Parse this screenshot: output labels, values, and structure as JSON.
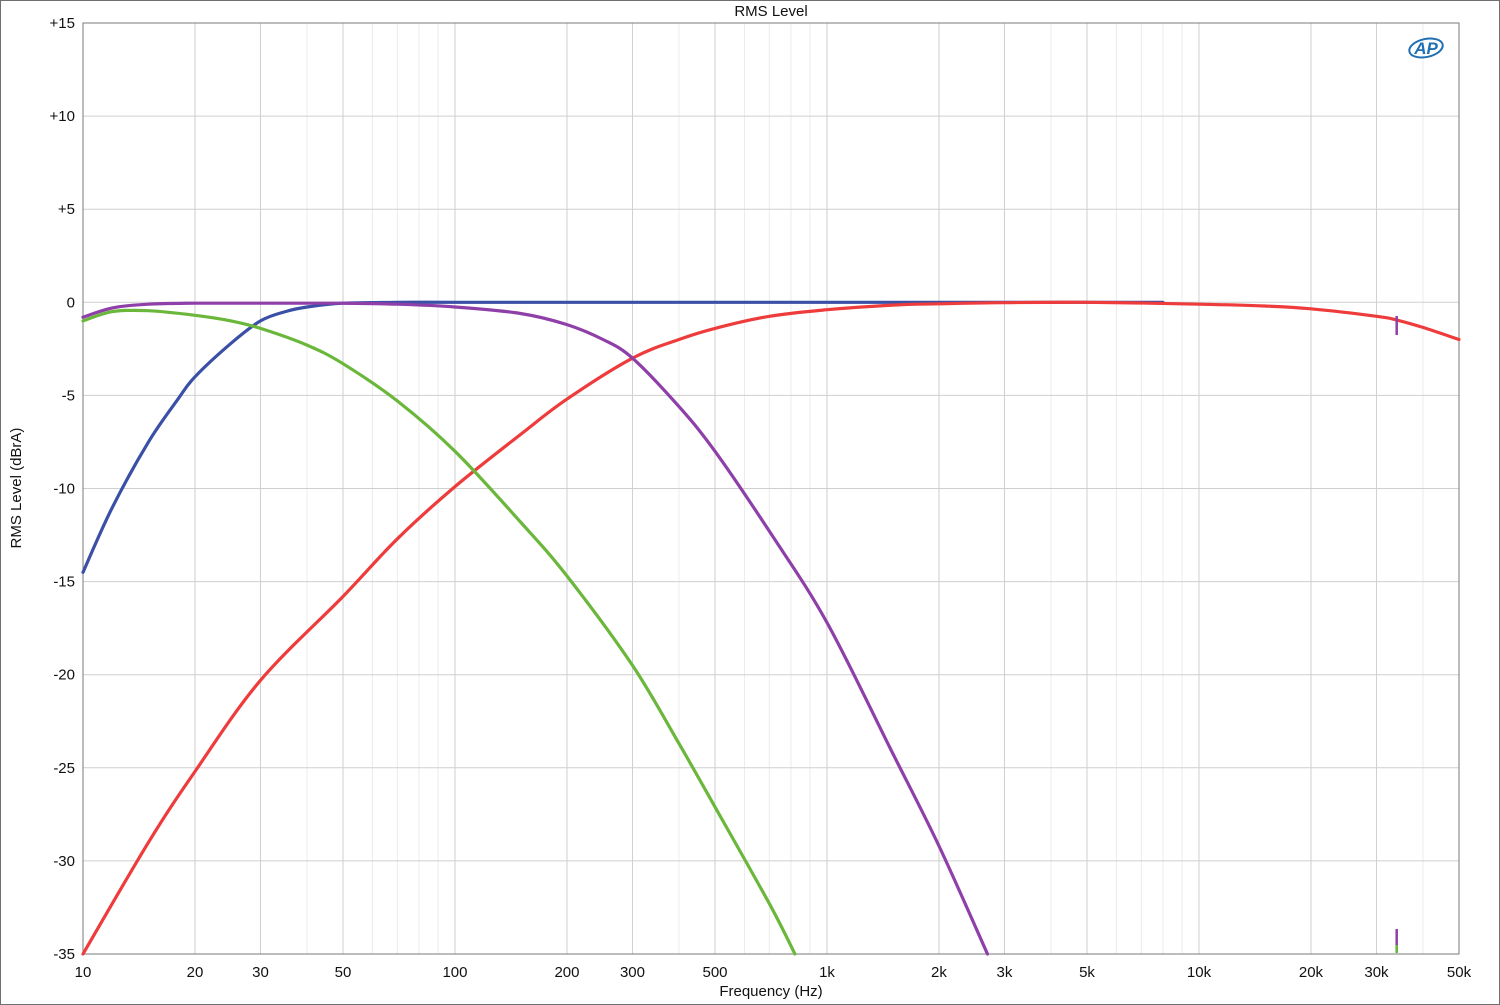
{
  "chart_data": {
    "type": "line",
    "title": "RMS Level",
    "xlabel": "Frequency (Hz)",
    "ylabel": "RMS Level (dBrA)",
    "x_scale": "log",
    "xlim": [
      10,
      50000
    ],
    "ylim": [
      -35,
      15
    ],
    "grid": true,
    "x_ticks": [
      {
        "value": 10,
        "label": "10"
      },
      {
        "value": 20,
        "label": "20"
      },
      {
        "value": 30,
        "label": "30"
      },
      {
        "value": 50,
        "label": "50"
      },
      {
        "value": 100,
        "label": "100"
      },
      {
        "value": 200,
        "label": "200"
      },
      {
        "value": 300,
        "label": "300"
      },
      {
        "value": 500,
        "label": "500"
      },
      {
        "value": 1000,
        "label": "1k"
      },
      {
        "value": 2000,
        "label": "2k"
      },
      {
        "value": 3000,
        "label": "3k"
      },
      {
        "value": 5000,
        "label": "5k"
      },
      {
        "value": 10000,
        "label": "10k"
      },
      {
        "value": 20000,
        "label": "20k"
      },
      {
        "value": 30000,
        "label": "30k"
      },
      {
        "value": 50000,
        "label": "50k"
      }
    ],
    "y_ticks": [
      {
        "value": 15,
        "label": "+15"
      },
      {
        "value": 10,
        "label": "+10"
      },
      {
        "value": 5,
        "label": "+5"
      },
      {
        "value": 0,
        "label": "0"
      },
      {
        "value": -5,
        "label": "-5"
      },
      {
        "value": -10,
        "label": "-10"
      },
      {
        "value": -15,
        "label": "-15"
      },
      {
        "value": -20,
        "label": "-20"
      },
      {
        "value": -25,
        "label": "-25"
      },
      {
        "value": -30,
        "label": "-30"
      },
      {
        "value": -35,
        "label": "-35"
      }
    ],
    "series": [
      {
        "color": "#3a4fa6",
        "x": [
          10,
          12,
          15,
          18,
          20,
          25,
          30,
          35,
          40,
          50,
          70,
          100,
          200,
          500,
          1000,
          2000,
          5000,
          8000
        ],
        "y": [
          -14.5,
          -11.0,
          -7.5,
          -5.2,
          -4.0,
          -2.2,
          -1.0,
          -0.5,
          -0.25,
          -0.05,
          0,
          0,
          0,
          0,
          0,
          0,
          0,
          0
        ]
      },
      {
        "color": "#ee3b3b",
        "x": [
          10,
          15,
          20,
          30,
          50,
          70,
          100,
          150,
          200,
          300,
          400,
          500,
          700,
          1000,
          1500,
          2000,
          3000,
          5000,
          10000,
          15000,
          20000,
          30000,
          34000,
          40000,
          50000
        ],
        "y": [
          -35.0,
          -29.0,
          -25.2,
          -20.3,
          -15.8,
          -12.7,
          -9.9,
          -7.1,
          -5.2,
          -3.0,
          -2.0,
          -1.4,
          -0.75,
          -0.4,
          -0.15,
          -0.08,
          -0.02,
          0,
          -0.1,
          -0.2,
          -0.35,
          -0.75,
          -0.95,
          -1.35,
          -2.0
        ]
      },
      {
        "color": "#8e3fa8",
        "x": [
          10,
          12,
          15,
          20,
          30,
          50,
          70,
          100,
          150,
          200,
          250,
          300,
          400,
          500,
          700,
          1000,
          1500,
          2000,
          2700
        ],
        "y": [
          -0.8,
          -0.3,
          -0.1,
          -0.05,
          -0.05,
          -0.05,
          -0.1,
          -0.25,
          -0.6,
          -1.2,
          -2.0,
          -3.0,
          -5.6,
          -8.0,
          -12.3,
          -17.2,
          -24.2,
          -29.2,
          -35.0
        ]
      },
      {
        "color": "#6ab73b",
        "x": [
          10,
          12,
          15,
          20,
          25,
          30,
          40,
          50,
          70,
          100,
          150,
          200,
          300,
          400,
          500,
          700,
          820
        ],
        "y": [
          -1.0,
          -0.5,
          -0.45,
          -0.7,
          -1.0,
          -1.4,
          -2.3,
          -3.3,
          -5.3,
          -8.0,
          -11.8,
          -14.7,
          -19.5,
          -23.7,
          -27.1,
          -32.3,
          -35.0
        ]
      }
    ]
  },
  "logo": {
    "text": "AP"
  }
}
